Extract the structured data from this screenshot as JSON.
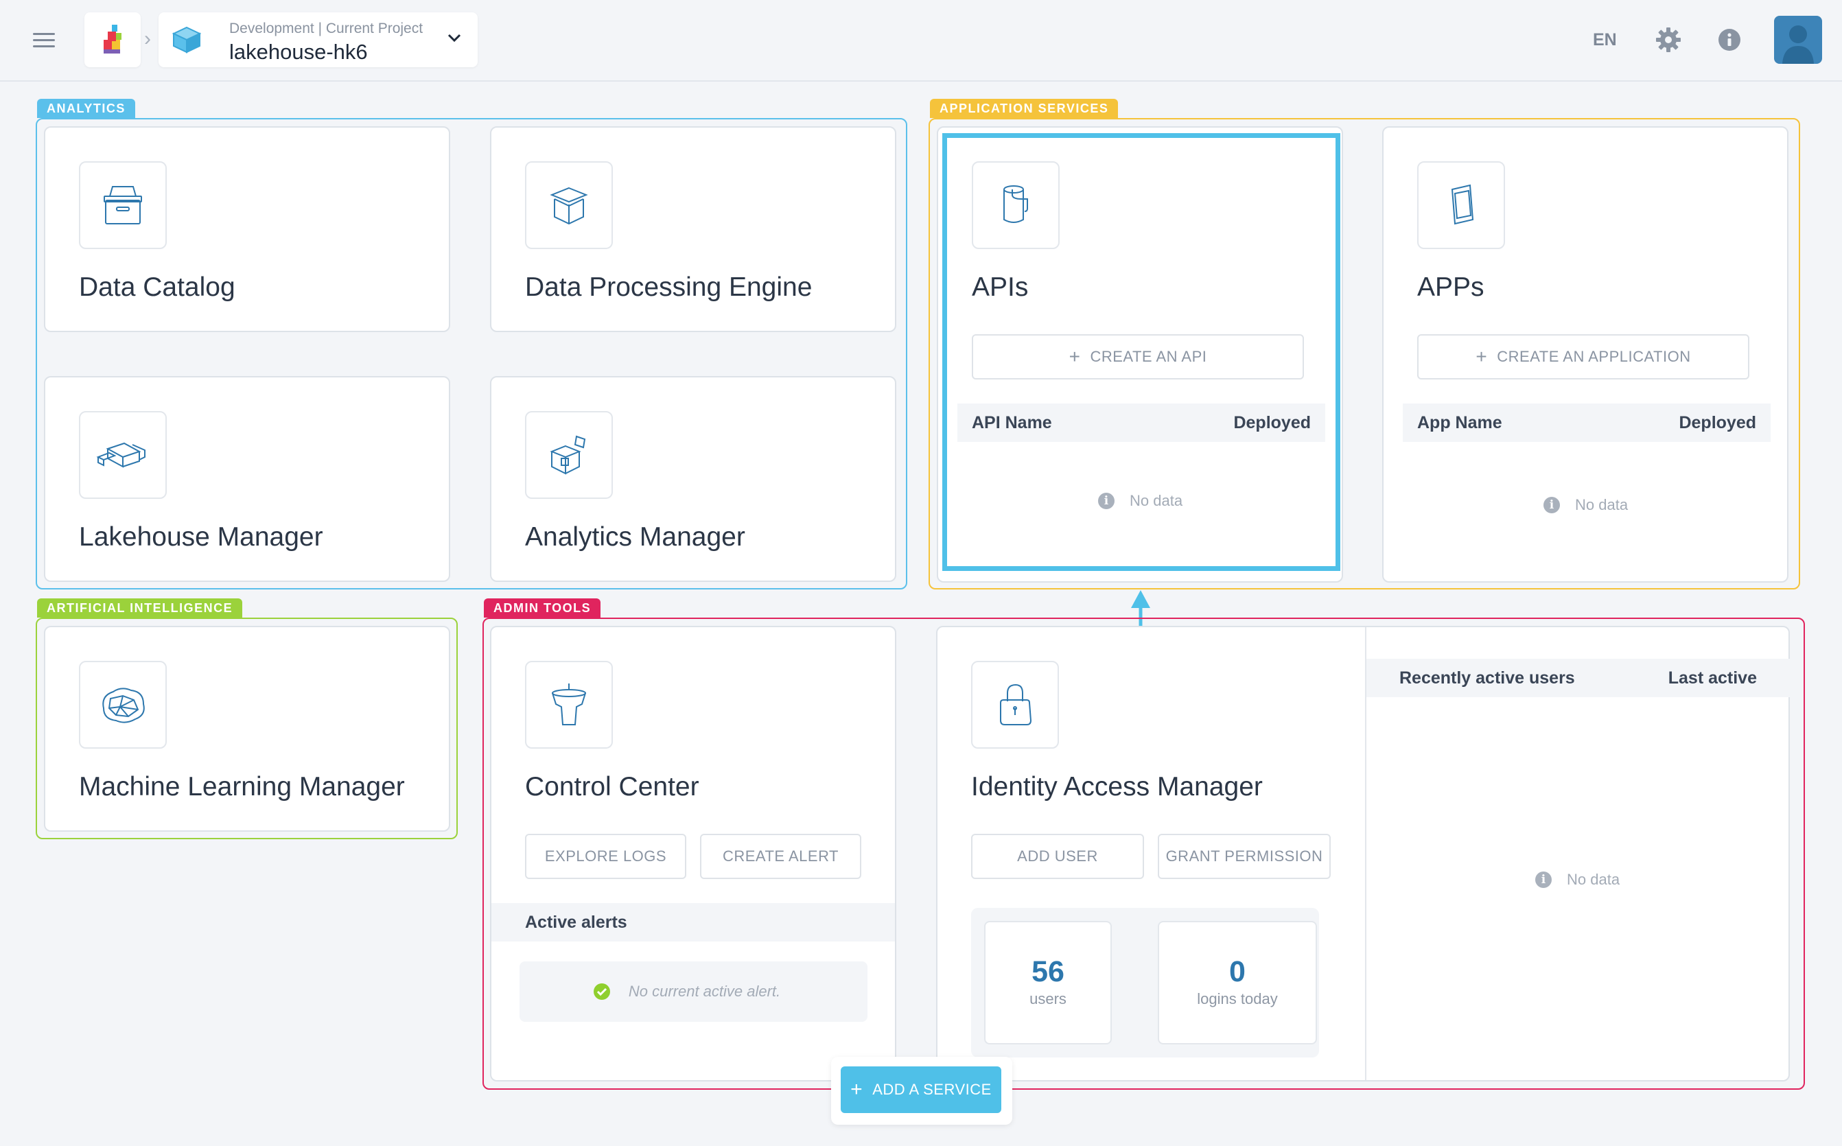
{
  "topbar": {
    "project_breadcrumb": "Development | Current Project",
    "project_name": "lakehouse-hk6",
    "language": "EN"
  },
  "groups": {
    "analytics": "ANALYTICS",
    "application_services": "APPLICATION SERVICES",
    "artificial_intelligence": "ARTIFICIAL INTELLIGENCE",
    "admin_tools": "ADMIN TOOLS"
  },
  "colors": {
    "analytics": "#5bc0eb",
    "application_services": "#f5c33b",
    "artificial_intelligence": "#9bd23b",
    "admin_tools": "#e0245e",
    "highlight": "#4fc0e8"
  },
  "analytics": {
    "data_catalog": "Data Catalog",
    "data_processing_engine": "Data Processing Engine",
    "lakehouse_manager": "Lakehouse Manager",
    "analytics_manager": "Analytics Manager"
  },
  "apis": {
    "title": "APIs",
    "create_button": "CREATE AN API",
    "col_name": "API Name",
    "col_deployed": "Deployed",
    "empty": "No data"
  },
  "apps": {
    "title": "APPs",
    "create_button": "CREATE AN APPLICATION",
    "col_name": "App Name",
    "col_deployed": "Deployed",
    "empty": "No data"
  },
  "ai": {
    "ml_manager": "Machine Learning Manager"
  },
  "control_center": {
    "title": "Control Center",
    "explore_logs": "EXPLORE LOGS",
    "create_alert": "CREATE ALERT",
    "active_alerts_header": "Active alerts",
    "no_alert": "No current active alert."
  },
  "iam": {
    "title": "Identity Access Manager",
    "add_user": "ADD USER",
    "grant_permission": "GRANT PERMISSION",
    "users_count": "56",
    "users_label": "users",
    "logins_count": "0",
    "logins_label": "logins today",
    "recent_users_header": "Recently active users",
    "last_active_header": "Last active",
    "empty": "No data"
  },
  "add_service": "ADD A SERVICE",
  "icons": [
    "menu-icon",
    "app-logo-icon",
    "project-cube-icon",
    "chevron-down-icon",
    "gear-icon",
    "info-icon",
    "user-avatar-icon",
    "archive-box-icon",
    "open-box-icon",
    "layers-icon",
    "cube-analytics-icon",
    "api-cylinder-icon",
    "mobile-app-icon",
    "brain-icon",
    "funnel-icon",
    "padlock-icon",
    "check-circle-icon",
    "plus-icon",
    "arrow-up-icon"
  ]
}
